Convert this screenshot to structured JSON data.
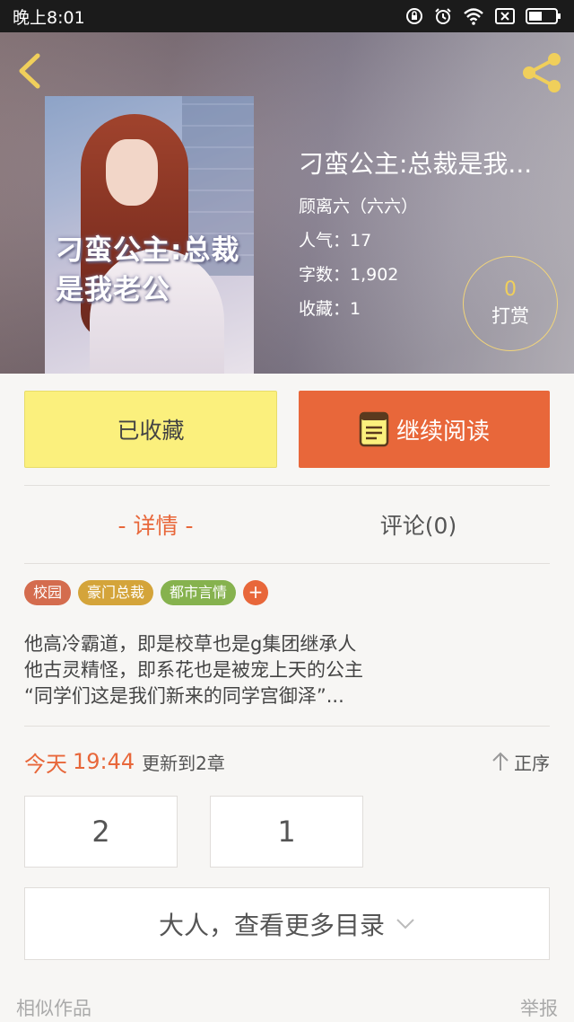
{
  "status_bar": {
    "time": "晚上8:01",
    "icons": [
      "lock-rotation-icon",
      "alarm-icon",
      "wifi-icon",
      "sim-icon",
      "battery-icon"
    ]
  },
  "header": {
    "back_icon": "chevron-left-icon",
    "share_icon": "share-icon",
    "accent_color": "#f0cf5b"
  },
  "book": {
    "cover_title": "刁蛮公主:总裁是我老公",
    "title": "刁蛮公主:总裁是我...",
    "author": "顾离六（六六）",
    "popularity": "人气：17",
    "word_count": "字数：1,902",
    "favorites": "收藏：1"
  },
  "tip": {
    "count": "0",
    "label": "打赏"
  },
  "actions": {
    "collected_label": "已收藏",
    "read_label": "继续阅读",
    "read_color": "#e8673a",
    "collected_color": "#fbf07d"
  },
  "tabs": [
    {
      "label": "- 详情 -",
      "active": true
    },
    {
      "label": "评论(0)",
      "active": false
    }
  ],
  "tags": [
    {
      "label": "校园",
      "color": "#d46c4e"
    },
    {
      "label": "豪门总裁",
      "color": "#d4a43a"
    },
    {
      "label": "都市言情",
      "color": "#86b24e"
    }
  ],
  "tag_plus": "+",
  "intro": [
    "他高冷霸道，即是校草也是g集团继承人",
    "他古灵精怪，即系花也是被宠上天的公主",
    "“同学们这是我们新来的同学宫御泽”..."
  ],
  "update": {
    "day": "今天",
    "time": "19:44",
    "text": "更新到2章",
    "sort_label": "正序"
  },
  "chapters": [
    "2",
    "1"
  ],
  "more_catalog": "大人，查看更多目录",
  "footer": {
    "similar": "相似作品",
    "report": "举报"
  }
}
